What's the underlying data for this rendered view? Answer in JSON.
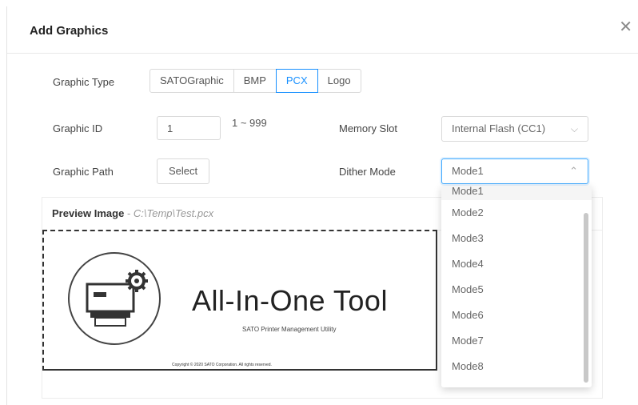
{
  "dialog": {
    "title": "Add Graphics",
    "close_icon": "close-icon"
  },
  "graphic_type": {
    "label": "Graphic Type",
    "options": [
      "SATOGraphic",
      "BMP",
      "PCX",
      "Logo"
    ],
    "selected": "PCX"
  },
  "graphic_id": {
    "label": "Graphic ID",
    "value": "1",
    "range": "1 ~ 999"
  },
  "memory_slot": {
    "label": "Memory Slot",
    "value": "Internal Flash (CC1)"
  },
  "graphic_path": {
    "label": "Graphic Path",
    "button": "Select"
  },
  "dither_mode": {
    "label": "Dither Mode",
    "value": "Mode1",
    "options": [
      "Mode1",
      "Mode2",
      "Mode3",
      "Mode4",
      "Mode5",
      "Mode6",
      "Mode7",
      "Mode8"
    ]
  },
  "preview": {
    "title": "Preview Image",
    "separator": " - ",
    "path": "C:\\Temp\\Test.pcx",
    "image_title": "All-In-One Tool",
    "image_subtitle": "SATO Printer Management Utility",
    "image_copyright": "Copyright © 2020 SATO Corporation. All rights reserved."
  },
  "colors": {
    "accent": "#1890ff",
    "border": "#d9d9d9"
  }
}
